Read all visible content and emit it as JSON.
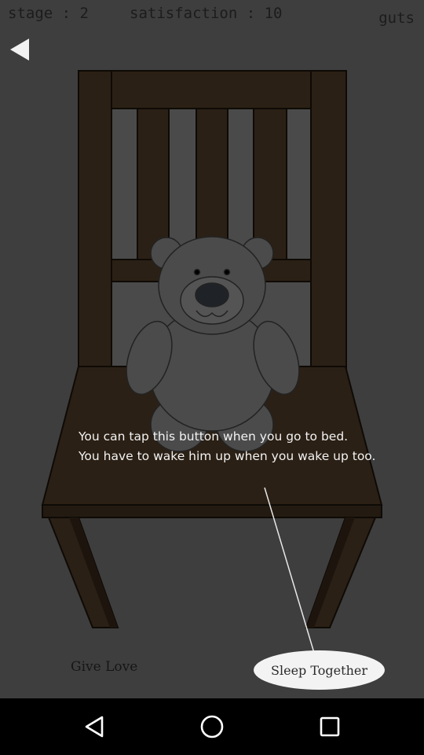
{
  "hud": {
    "stage": "stage : 2",
    "satisfaction": "satisfaction : 10",
    "guts": "guts"
  },
  "tutorial": {
    "line1": "You can tap this button when you go to bed.",
    "line2": "You have to wake him up when you wake up too."
  },
  "actions": {
    "give_love": "Give Love",
    "sleep_together": "Sleep Together"
  },
  "icons": {
    "back": "back-arrow-icon",
    "nav_back": "triangle-back-icon",
    "nav_home": "circle-home-icon",
    "nav_recent": "square-recent-icon"
  },
  "colors": {
    "overlay_background": "#3e3e3e",
    "chair_wood": "#2b2015",
    "bear": "#4a4a4a",
    "button_fill": "#f3f3f3"
  }
}
